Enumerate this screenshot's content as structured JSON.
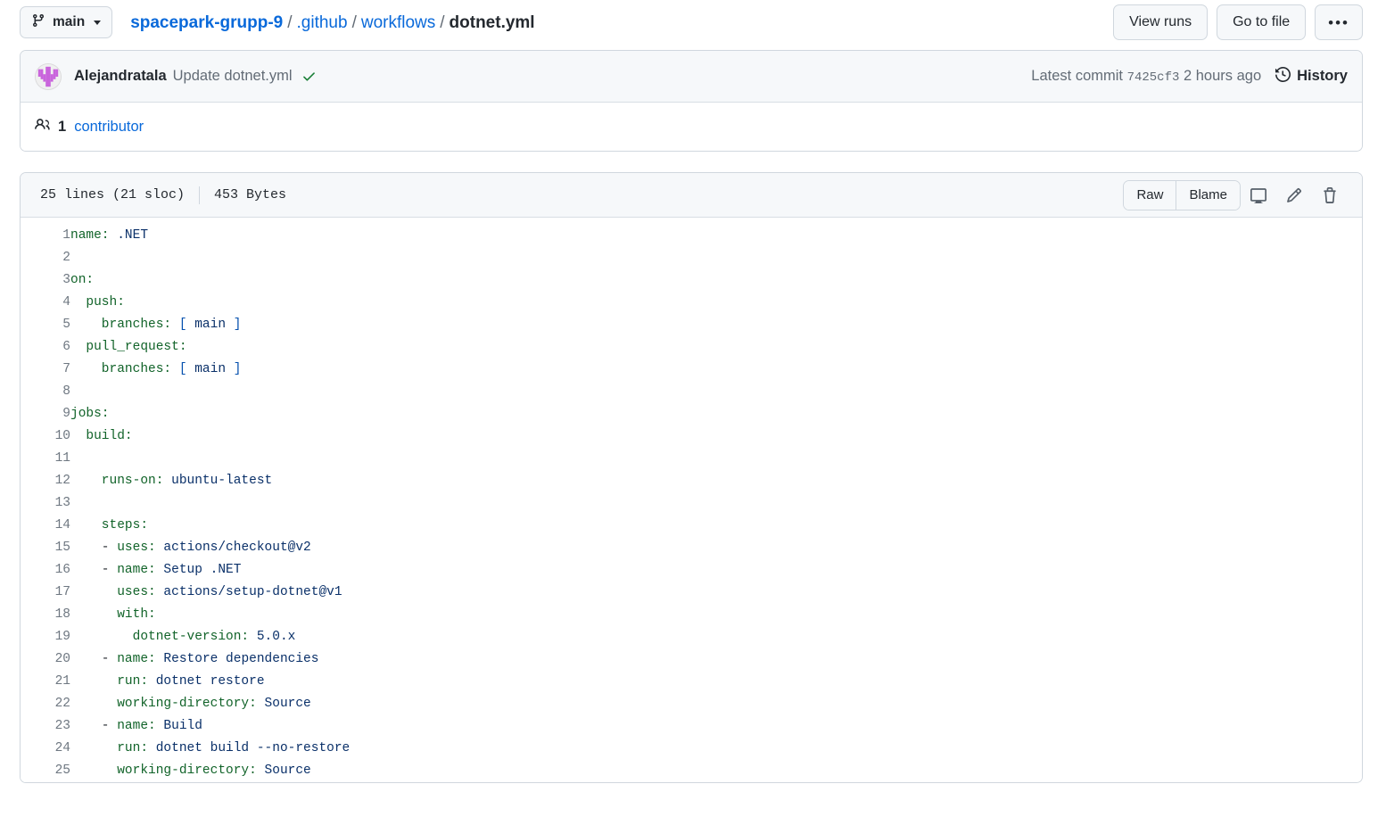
{
  "topbar": {
    "branch_button": {
      "label": "main",
      "icon": "git-branch-icon",
      "caret": "chevron-down-icon"
    },
    "breadcrumb": {
      "repo": "spacepark-grupp-9",
      "segments": [
        ".github",
        "workflows"
      ],
      "current": "dotnet.yml",
      "separator": "/"
    },
    "actions": {
      "view_runs": "View runs",
      "go_to_file": "Go to file",
      "kebab": "•••"
    }
  },
  "commit": {
    "author": "Alejandratala",
    "message": "Update dotnet.yml",
    "status_icon": "check-icon",
    "status_color": "#1a7f37",
    "avatar_color": "#c964dc",
    "latest_commit_label": "Latest commit",
    "sha": "7425cf3",
    "time": "2 hours ago",
    "history_label": "History",
    "history_icon": "history-clock-icon",
    "contributors": {
      "count": "1",
      "label": "contributor",
      "icon": "people-icon"
    }
  },
  "file": {
    "lines_info": "25 lines (21 sloc)",
    "size": "453 Bytes",
    "actions": {
      "raw": "Raw",
      "blame": "Blame",
      "open_desktop_icon": "desktop-download-icon",
      "edit_icon": "pencil-icon",
      "delete_icon": "trash-icon"
    },
    "code_lines": [
      {
        "n": "1",
        "tokens": [
          {
            "t": "name:",
            "c": "k"
          },
          {
            "t": " .NET",
            "c": "v"
          }
        ]
      },
      {
        "n": "2",
        "tokens": []
      },
      {
        "n": "3",
        "tokens": [
          {
            "t": "on:",
            "c": "k"
          }
        ]
      },
      {
        "n": "4",
        "tokens": [
          {
            "t": "  push:",
            "c": "k"
          }
        ]
      },
      {
        "n": "5",
        "tokens": [
          {
            "t": "    branches:",
            "c": "k"
          },
          {
            "t": " ",
            "c": "p"
          },
          {
            "t": "[",
            "c": "br"
          },
          {
            "t": " main ",
            "c": "v"
          },
          {
            "t": "]",
            "c": "br"
          }
        ]
      },
      {
        "n": "6",
        "tokens": [
          {
            "t": "  pull_request:",
            "c": "k"
          }
        ]
      },
      {
        "n": "7",
        "tokens": [
          {
            "t": "    branches:",
            "c": "k"
          },
          {
            "t": " ",
            "c": "p"
          },
          {
            "t": "[",
            "c": "br"
          },
          {
            "t": " main ",
            "c": "v"
          },
          {
            "t": "]",
            "c": "br"
          }
        ]
      },
      {
        "n": "8",
        "tokens": []
      },
      {
        "n": "9",
        "tokens": [
          {
            "t": "jobs:",
            "c": "k"
          }
        ]
      },
      {
        "n": "10",
        "tokens": [
          {
            "t": "  build:",
            "c": "k"
          }
        ]
      },
      {
        "n": "11",
        "tokens": []
      },
      {
        "n": "12",
        "tokens": [
          {
            "t": "    runs-on:",
            "c": "k"
          },
          {
            "t": " ubuntu-latest",
            "c": "v"
          }
        ]
      },
      {
        "n": "13",
        "tokens": []
      },
      {
        "n": "14",
        "tokens": [
          {
            "t": "    steps:",
            "c": "k"
          }
        ]
      },
      {
        "n": "15",
        "tokens": [
          {
            "t": "    - ",
            "c": "p"
          },
          {
            "t": "uses:",
            "c": "k"
          },
          {
            "t": " actions/checkout@v2",
            "c": "v"
          }
        ]
      },
      {
        "n": "16",
        "tokens": [
          {
            "t": "    - ",
            "c": "p"
          },
          {
            "t": "name:",
            "c": "k"
          },
          {
            "t": " Setup .NET",
            "c": "v"
          }
        ]
      },
      {
        "n": "17",
        "tokens": [
          {
            "t": "      uses:",
            "c": "k"
          },
          {
            "t": " actions/setup-dotnet@v1",
            "c": "v"
          }
        ]
      },
      {
        "n": "18",
        "tokens": [
          {
            "t": "      with:",
            "c": "k"
          }
        ]
      },
      {
        "n": "19",
        "tokens": [
          {
            "t": "        dotnet-version:",
            "c": "k"
          },
          {
            "t": " 5.0.x",
            "c": "v"
          }
        ]
      },
      {
        "n": "20",
        "tokens": [
          {
            "t": "    - ",
            "c": "p"
          },
          {
            "t": "name:",
            "c": "k"
          },
          {
            "t": " Restore dependencies",
            "c": "v"
          }
        ]
      },
      {
        "n": "21",
        "tokens": [
          {
            "t": "      run:",
            "c": "k"
          },
          {
            "t": " dotnet restore",
            "c": "v"
          }
        ]
      },
      {
        "n": "22",
        "tokens": [
          {
            "t": "      working-directory:",
            "c": "k"
          },
          {
            "t": " Source",
            "c": "v"
          }
        ]
      },
      {
        "n": "23",
        "tokens": [
          {
            "t": "    - ",
            "c": "p"
          },
          {
            "t": "name:",
            "c": "k"
          },
          {
            "t": " Build",
            "c": "v"
          }
        ]
      },
      {
        "n": "24",
        "tokens": [
          {
            "t": "      run:",
            "c": "k"
          },
          {
            "t": " dotnet build --no-restore",
            "c": "v"
          }
        ]
      },
      {
        "n": "25",
        "tokens": [
          {
            "t": "      working-directory:",
            "c": "k"
          },
          {
            "t": " Source",
            "c": "v"
          }
        ]
      }
    ]
  }
}
